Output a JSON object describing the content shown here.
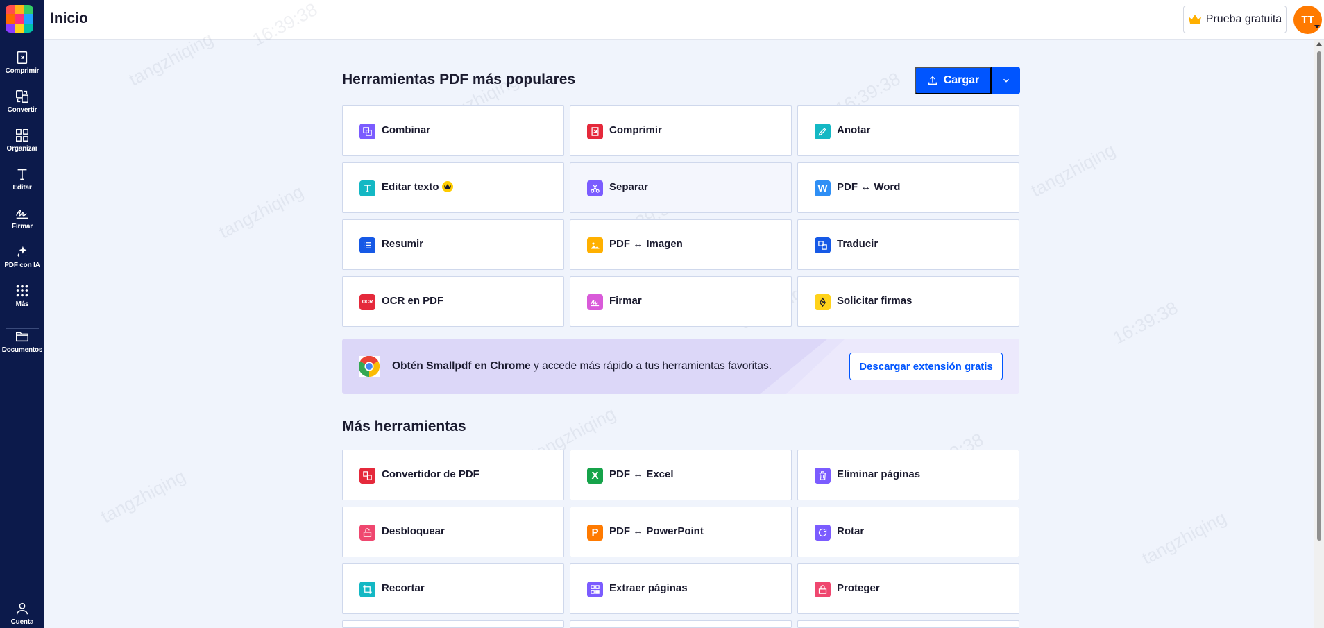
{
  "sidebar": {
    "logo_colors": [
      "#ff4d4d",
      "#ffb31a",
      "#33cc66",
      "#ff6a00",
      "#ff2e7a",
      "#1fa4ff",
      "#8a3bff",
      "#ffd21a",
      "#00c2a8"
    ],
    "items": [
      {
        "label": "Comprimir",
        "icon": "compress-icon"
      },
      {
        "label": "Convertir",
        "icon": "convert-icon"
      },
      {
        "label": "Organizar",
        "icon": "organize-icon"
      },
      {
        "label": "Editar",
        "icon": "edit-text-icon"
      },
      {
        "label": "Firmar",
        "icon": "sign-icon"
      },
      {
        "label": "PDF con IA",
        "icon": "sparkle-icon"
      },
      {
        "label": "Más",
        "icon": "grid-icon"
      },
      {
        "label": "Documentos",
        "icon": "folder-icon"
      }
    ],
    "account_label": "Cuenta"
  },
  "header": {
    "title": "Inicio",
    "trial_label": "Prueba gratuita",
    "avatar_initials": "TT"
  },
  "popular": {
    "title": "Herramientas PDF más populares",
    "upload_label": "Cargar",
    "tools": [
      {
        "label": "Combinar",
        "icon": "merge-icon",
        "color": "#7b5cff"
      },
      {
        "label": "Comprimir",
        "icon": "compress-icon",
        "color": "#e5293b"
      },
      {
        "label": "Anotar",
        "icon": "pencil-icon",
        "color": "#14b8c4"
      },
      {
        "label": "Editar texto",
        "icon": "text-icon",
        "color": "#14b8c4"
      },
      {
        "label": "Separar",
        "icon": "scissors-icon",
        "color": "#7b5cff"
      },
      {
        "label": "PDF ↔ Word",
        "icon": "word-icon",
        "color": "#2f8ff5"
      },
      {
        "label": "Resumir",
        "icon": "list-icon",
        "color": "#1659e6"
      },
      {
        "label": "PDF ↔ Imagen",
        "icon": "image-icon",
        "color": "#ffb000"
      },
      {
        "label": "Traducir",
        "icon": "translate-icon",
        "color": "#1659e6"
      },
      {
        "label": "OCR en PDF",
        "icon": "ocr-icon",
        "color": "#e5293b"
      },
      {
        "label": "Firmar",
        "icon": "signature-icon",
        "color": "#d95ad9"
      },
      {
        "label": "Solicitar firmas",
        "icon": "pen-nib-icon",
        "color": "#ffd21a"
      }
    ]
  },
  "banner": {
    "bold_text": "Obtén Smallpdf en Chrome",
    "text": " y accede más rápido a tus herramientas favoritas.",
    "button_label": "Descargar extensión gratis"
  },
  "more": {
    "title": "Más herramientas",
    "tools": [
      {
        "label": "Convertidor de PDF",
        "icon": "converter-icon",
        "color": "#e5293b"
      },
      {
        "label": "PDF ↔ Excel",
        "icon": "excel-icon",
        "color": "#16a34a"
      },
      {
        "label": "Eliminar páginas",
        "icon": "trash-icon",
        "color": "#7b5cff"
      },
      {
        "label": "Desbloquear",
        "icon": "unlock-icon",
        "color": "#ef476f"
      },
      {
        "label": "PDF ↔ PowerPoint",
        "icon": "powerpoint-icon",
        "color": "#ff7a00"
      },
      {
        "label": "Rotar",
        "icon": "rotate-icon",
        "color": "#7b5cff"
      },
      {
        "label": "Recortar",
        "icon": "crop-icon",
        "color": "#14b8c4"
      },
      {
        "label": "Extraer páginas",
        "icon": "extract-icon",
        "color": "#7b5cff"
      },
      {
        "label": "Proteger",
        "icon": "lock-icon",
        "color": "#ef476f"
      }
    ]
  },
  "watermark": {
    "user": "tangzhiqing",
    "time": "16:39:38"
  }
}
